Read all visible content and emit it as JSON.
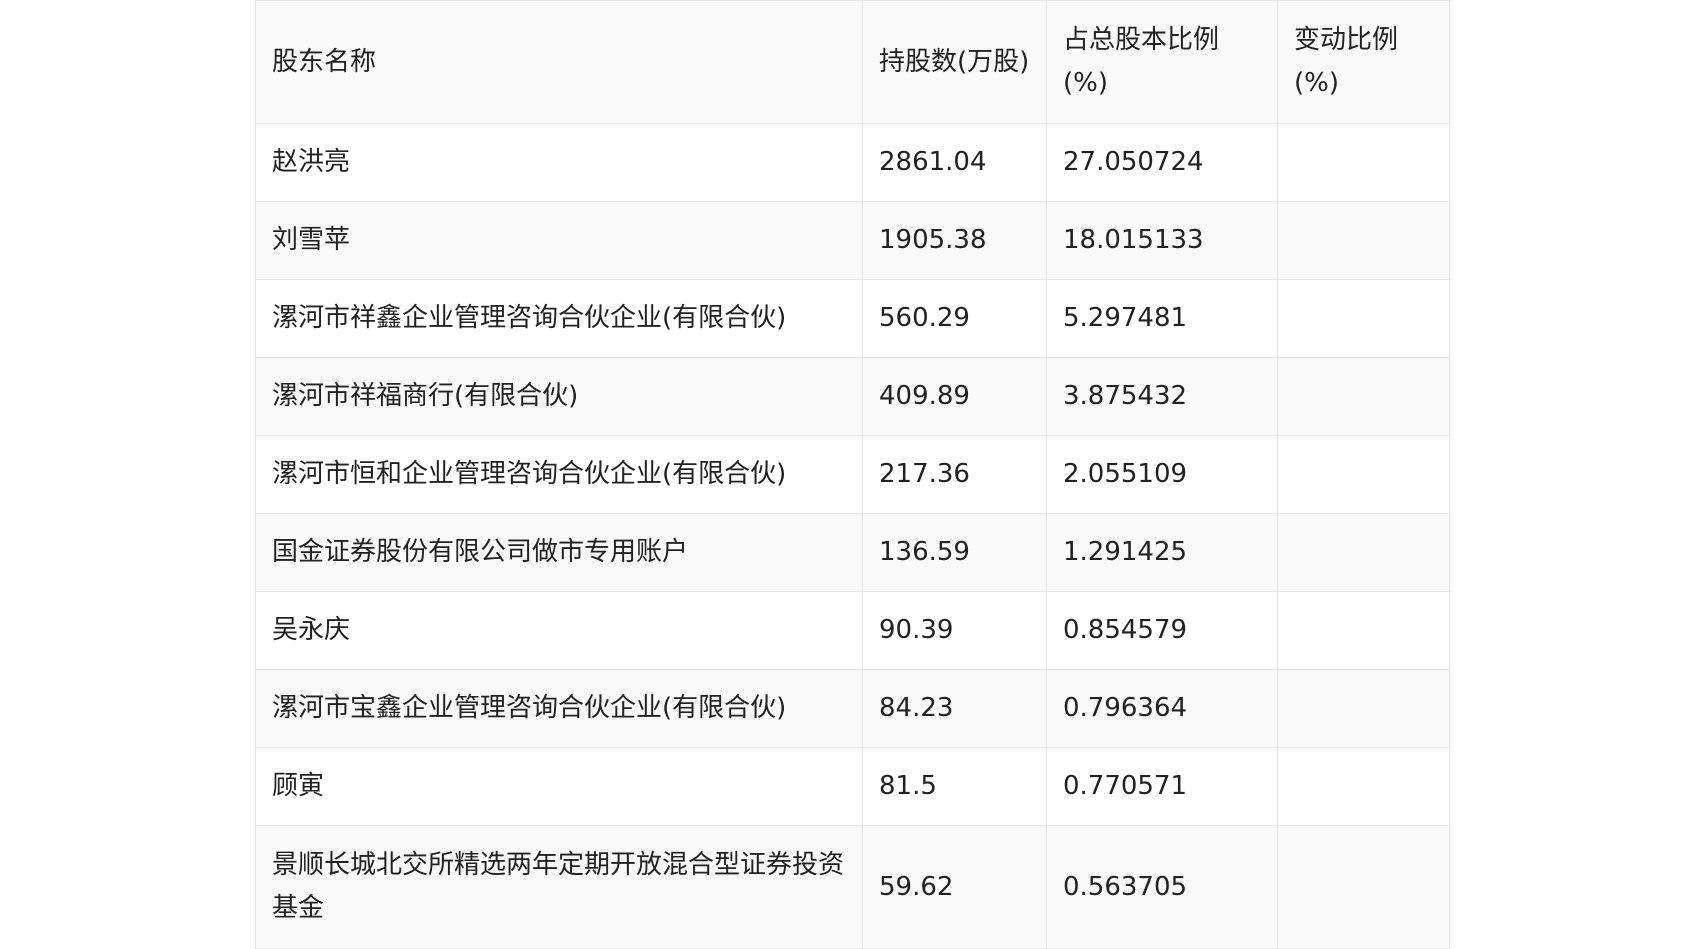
{
  "table": {
    "headers": [
      "股东名称",
      "持股数(万股)",
      "占总股本比例(%)",
      "变动比例(%)"
    ],
    "rows": [
      [
        "赵洪亮",
        "2861.04",
        "27.050724",
        ""
      ],
      [
        "刘雪苹",
        "1905.38",
        "18.015133",
        ""
      ],
      [
        "漯河市祥鑫企业管理咨询合伙企业(有限合伙)",
        "560.29",
        "5.297481",
        ""
      ],
      [
        "漯河市祥福商行(有限合伙)",
        "409.89",
        "3.875432",
        ""
      ],
      [
        "漯河市恒和企业管理咨询合伙企业(有限合伙)",
        "217.36",
        "2.055109",
        ""
      ],
      [
        "国金证券股份有限公司做市专用账户",
        "136.59",
        "1.291425",
        ""
      ],
      [
        "吴永庆",
        "90.39",
        "0.854579",
        ""
      ],
      [
        "漯河市宝鑫企业管理咨询合伙企业(有限合伙)",
        "84.23",
        "0.796364",
        ""
      ],
      [
        "顾寅",
        "81.5",
        "0.770571",
        ""
      ],
      [
        "景顺长城北交所精选两年定期开放混合型证券投资基金",
        "59.62",
        "0.563705",
        ""
      ]
    ]
  }
}
